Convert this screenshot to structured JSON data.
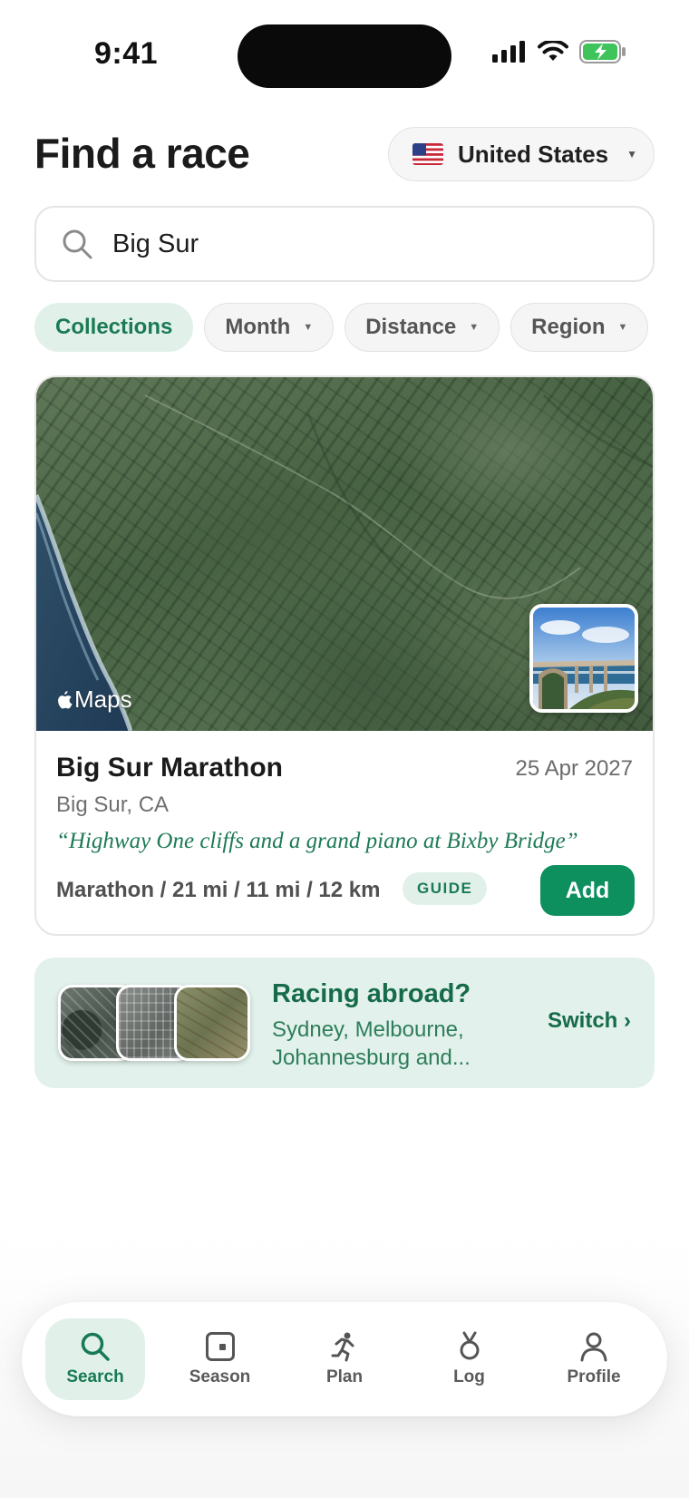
{
  "status_bar": {
    "time": "9:41"
  },
  "header": {
    "title": "Find a race",
    "country": "United States"
  },
  "search": {
    "value": "Big Sur"
  },
  "filters": {
    "collections": "Collections",
    "month": "Month",
    "distance": "Distance",
    "region": "Region"
  },
  "race": {
    "maps_label": "Maps",
    "name": "Big Sur Marathon",
    "date": "25 Apr 2027",
    "location": "Big Sur, CA",
    "tagline": "“Highway One cliffs and a grand piano at Bixby Bridge”",
    "distances": "Marathon / 21 mi / 11 mi / 12 km",
    "badge": "GUIDE",
    "add_label": "Add"
  },
  "abroad": {
    "title": "Racing abroad?",
    "subtitle": "Sydney, Melbourne, Johannesburg and...",
    "switch_label": "Switch ›"
  },
  "tabs": {
    "search": "Search",
    "season": "Season",
    "plan": "Plan",
    "log": "Log",
    "profile": "Profile"
  },
  "colors": {
    "accent": "#0d8f5e",
    "accent_text": "#1b7a55",
    "accent_bg": "#e1f1ea"
  }
}
